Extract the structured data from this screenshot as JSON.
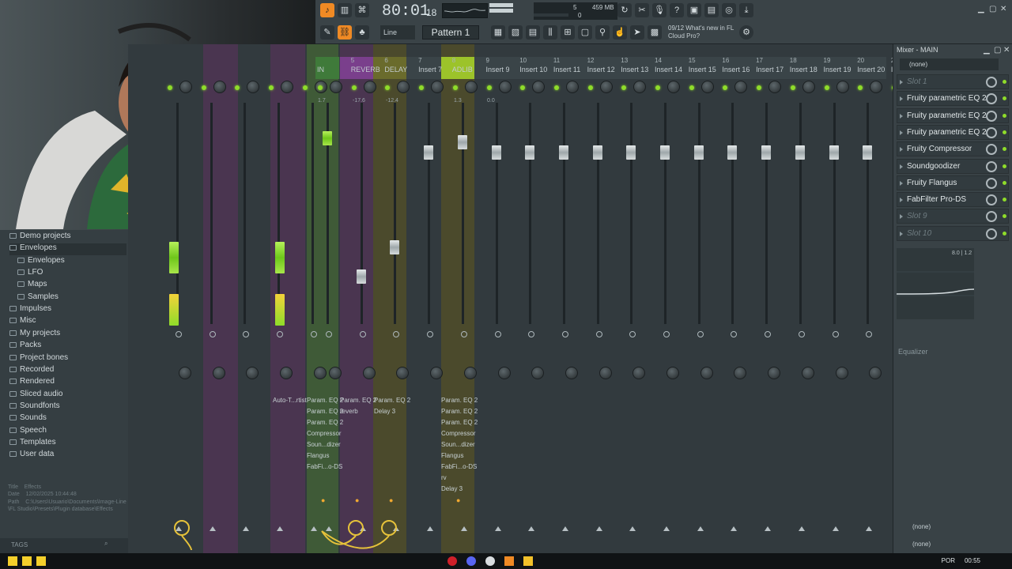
{
  "toolbar": {
    "time": "80:01",
    "time_ticks": "18",
    "time_unit": "B:S:T",
    "memory": "459 MB",
    "cpu_a": "5",
    "cpu_b": "0",
    "snap_mode": "Line",
    "pattern": "Pattern 1",
    "news_date": "09/12",
    "news_text": "What's new in FL Cloud Pro?"
  },
  "browser": {
    "items": [
      {
        "label": "Demo projects",
        "level": 0
      },
      {
        "label": "Envelopes",
        "level": 0,
        "highlight": true
      },
      {
        "label": "Envelopes",
        "level": 1
      },
      {
        "label": "LFO",
        "level": 1
      },
      {
        "label": "Maps",
        "level": 1
      },
      {
        "label": "Samples",
        "level": 1
      },
      {
        "label": "Impulses",
        "level": 0
      },
      {
        "label": "Misc",
        "level": 0
      },
      {
        "label": "My projects",
        "level": 0
      },
      {
        "label": "Packs",
        "level": 0
      },
      {
        "label": "Project bones",
        "level": 0
      },
      {
        "label": "Recorded",
        "level": 0
      },
      {
        "label": "Rendered",
        "level": 0
      },
      {
        "label": "Sliced audio",
        "level": 0
      },
      {
        "label": "Soundfonts",
        "level": 0
      },
      {
        "label": "Sounds",
        "level": 0
      },
      {
        "label": "Speech",
        "level": 0
      },
      {
        "label": "Templates",
        "level": 0
      },
      {
        "label": "User data",
        "level": 0
      }
    ],
    "meta_title_key": "Title",
    "meta_title": "Effects",
    "meta_date_key": "Date",
    "meta_date": "12/02/2025 10:44:48",
    "meta_path_key": "Path",
    "meta_path": "C:\\Users\\Usuario\\Documents\\Image-Line\\FL Studio\\Presets\\Plugin database\\Effects",
    "tags_label": "TAGS"
  },
  "mixer": {
    "headers": [
      {
        "num": "",
        "name": "IN"
      },
      {
        "num": "5",
        "name": "REVERB"
      },
      {
        "num": "6",
        "name": "DELAY"
      },
      {
        "num": "7",
        "name": "Insert 7"
      },
      {
        "num": "8",
        "name": "ADLIB"
      },
      {
        "num": "9",
        "name": "Insert 9"
      },
      {
        "num": "10",
        "name": "Insert 10"
      },
      {
        "num": "11",
        "name": "Insert 11"
      },
      {
        "num": "12",
        "name": "Insert 12"
      },
      {
        "num": "13",
        "name": "Insert 13"
      },
      {
        "num": "14",
        "name": "Insert 14"
      },
      {
        "num": "15",
        "name": "Insert 15"
      },
      {
        "num": "16",
        "name": "Insert 16"
      },
      {
        "num": "17",
        "name": "Insert 17"
      },
      {
        "num": "18",
        "name": "Insert 18"
      },
      {
        "num": "19",
        "name": "Insert 19"
      },
      {
        "num": "20",
        "name": "Insert 20"
      },
      {
        "num": "21",
        "name": "In"
      }
    ],
    "peak_values": [
      "1.7",
      "-17.6",
      "-12.4",
      "1.3",
      "0.0"
    ],
    "fx_col_autotune": [
      "Auto-T...rtist"
    ],
    "fx_col_in": [
      "Param. EQ 2",
      "Param. EQ 2",
      "Param. EQ 2",
      "Compressor",
      "Soun...dizer",
      "Flangus",
      "FabFi...o-DS"
    ],
    "fx_col_reverb": [
      "Param. EQ 2",
      "reverb"
    ],
    "fx_col_delay": [
      "Param. EQ 2",
      "Delay 3"
    ],
    "fx_col_adlib": [
      "Param. EQ 2",
      "Param. EQ 2",
      "Param. EQ 2",
      "Compressor",
      "Soun...dizer",
      "Flangus",
      "FabFi...o-DS",
      "rv",
      "Delay 3"
    ]
  },
  "insert_panel": {
    "title": "Mixer - MAIN",
    "input": "(none)",
    "slots": [
      {
        "label": "Slot 1",
        "empty": true
      },
      {
        "label": "Fruity parametric EQ 2",
        "empty": false
      },
      {
        "label": "Fruity parametric EQ 2",
        "empty": false
      },
      {
        "label": "Fruity parametric EQ 2",
        "empty": false
      },
      {
        "label": "Fruity Compressor",
        "empty": false
      },
      {
        "label": "Soundgoodizer",
        "empty": false
      },
      {
        "label": "Fruity Flangus",
        "empty": false
      },
      {
        "label": "FabFilter Pro-DS",
        "empty": false
      },
      {
        "label": "Slot 9",
        "empty": true
      },
      {
        "label": "Slot 10",
        "empty": true
      }
    ],
    "eq_readout": "8.0 | 1.2",
    "eq_label": "Equalizer",
    "output_a": "(none)",
    "output_b": "(none)"
  },
  "taskbar": {
    "lang": "POR",
    "clock": "00:55"
  },
  "colors": {
    "accent_orange": "#f08a24",
    "led_green": "#8fdc2a",
    "strip_purple": "#4a3550",
    "strip_olive": "#4b4a2c",
    "strip_green": "#3f5a37"
  }
}
